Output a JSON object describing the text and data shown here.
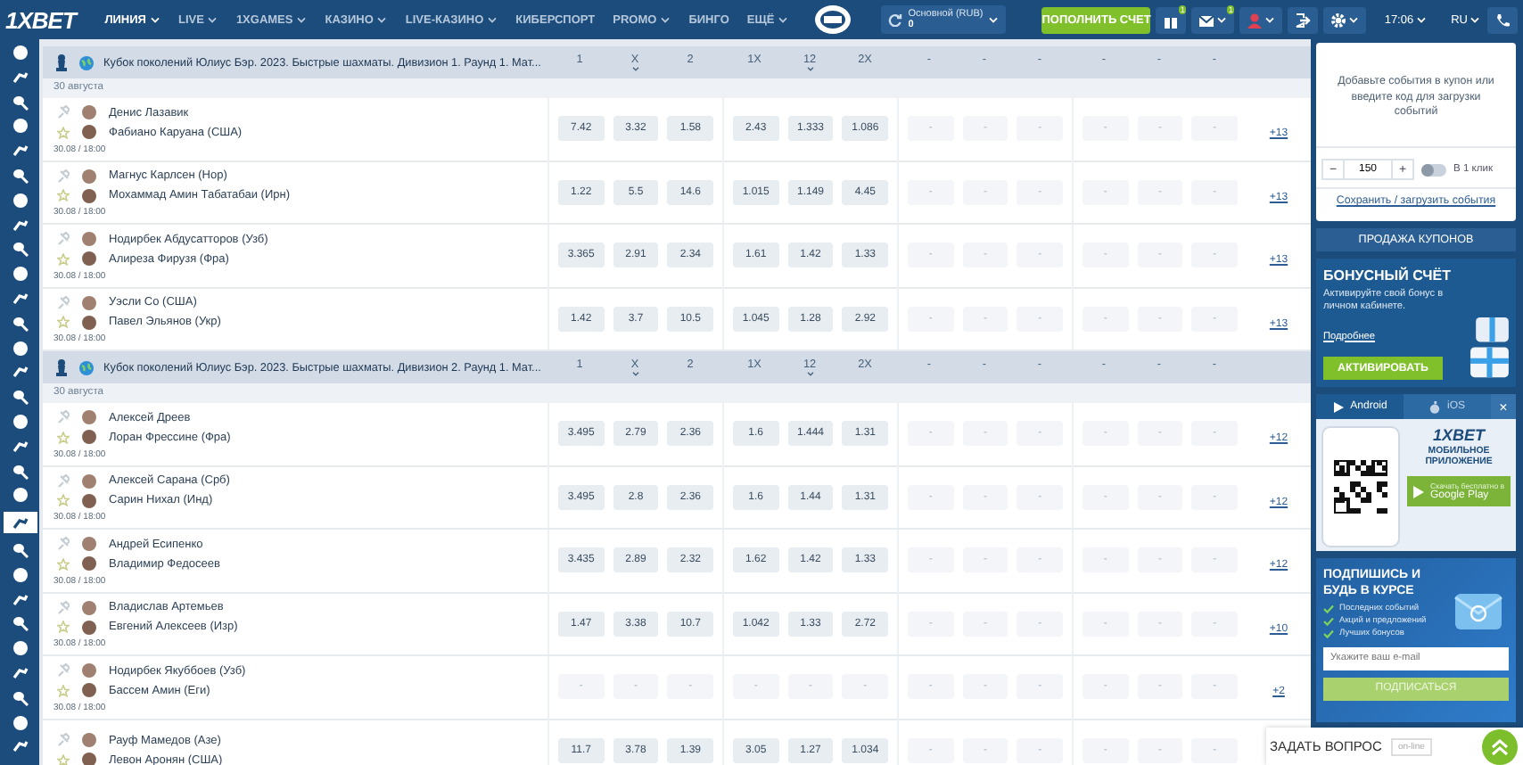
{
  "header": {
    "logo": "1XBET",
    "nav": [
      {
        "label": "ЛИНИЯ",
        "selected": true,
        "dropdown": true
      },
      {
        "label": "LIVE",
        "selected": false,
        "dropdown": true
      },
      {
        "label": "1XGAMES",
        "selected": false,
        "dropdown": true
      },
      {
        "label": "КАЗИНО",
        "selected": false,
        "dropdown": true
      },
      {
        "label": "LIVE-КАЗИНО",
        "selected": false,
        "dropdown": true
      },
      {
        "label": "КИБЕРСПОРТ",
        "selected": false,
        "dropdown": false
      },
      {
        "label": "PROMO",
        "selected": false,
        "dropdown": true
      },
      {
        "label": "БИНГО",
        "selected": false,
        "dropdown": false
      },
      {
        "label": "ЕЩЁ",
        "selected": false,
        "dropdown": true
      }
    ],
    "balance": {
      "account": "Основной (RUB)",
      "amount": "0"
    },
    "deposit_button": "ПОПОЛНИТЬ СЧЕТ",
    "gift_badge": "1",
    "mail_badge": "1",
    "time": "17:06",
    "language": "RU"
  },
  "sports_nav": [
    {
      "selected": false
    },
    {
      "selected": false
    },
    {
      "selected": false
    },
    {
      "selected": false
    },
    {
      "selected": false
    },
    {
      "selected": false
    },
    {
      "selected": false
    },
    {
      "selected": false
    },
    {
      "selected": false
    },
    {
      "selected": false
    },
    {
      "selected": false
    },
    {
      "selected": false
    },
    {
      "selected": false
    },
    {
      "selected": false
    },
    {
      "selected": false
    },
    {
      "selected": false
    },
    {
      "selected": false
    },
    {
      "selected": false
    },
    {
      "selected": false
    },
    {
      "selected": true
    },
    {
      "selected": false
    },
    {
      "selected": false
    },
    {
      "selected": false
    },
    {
      "selected": false
    },
    {
      "selected": false
    },
    {
      "selected": false
    },
    {
      "selected": false
    },
    {
      "selected": false
    },
    {
      "selected": false
    }
  ],
  "groups": [
    {
      "title": "Кубок поколений Юлиус Бэр. 2023. Быстрые шахматы. Дивизион 1. Раунд 1. Мат...",
      "date": "30 августа",
      "columns": [
        {
          "label": "1",
          "caret": false
        },
        {
          "label": "X",
          "caret": true
        },
        {
          "label": "2",
          "caret": false
        },
        {
          "label": "1X",
          "caret": false
        },
        {
          "label": "12",
          "caret": true
        },
        {
          "label": "2X",
          "caret": false
        }
      ],
      "extra_columns": [
        "-",
        "-",
        "-",
        "-",
        "-",
        "-"
      ],
      "matches": [
        {
          "team1": "Денис Лазавик",
          "team2": "Фабиано Каруана (США)",
          "when": "30.08 / 18:00",
          "locked": false,
          "odds": [
            "7.42",
            "3.32",
            "1.58",
            "2.43",
            "1.333",
            "1.086"
          ],
          "extra_odds": [
            "-",
            "-",
            "-",
            "-",
            "-",
            "-"
          ],
          "more": "+13"
        },
        {
          "team1": "Магнус Карлсен (Нор)",
          "team2": "Мохаммад Амин Табатабаи (Ирн)",
          "when": "30.08 / 18:00",
          "locked": false,
          "odds": [
            "1.22",
            "5.5",
            "14.6",
            "1.015",
            "1.149",
            "4.45"
          ],
          "extra_odds": [
            "-",
            "-",
            "-",
            "-",
            "-",
            "-"
          ],
          "more": "+13"
        },
        {
          "team1": "Нодирбек Абдусатторов (Узб)",
          "team2": "Алиреза Фирузя (Фра)",
          "when": "30.08 / 18:00",
          "locked": false,
          "odds": [
            "3.365",
            "2.91",
            "2.34",
            "1.61",
            "1.42",
            "1.33"
          ],
          "extra_odds": [
            "-",
            "-",
            "-",
            "-",
            "-",
            "-"
          ],
          "more": "+13"
        },
        {
          "team1": "Уэсли Со (США)",
          "team2": "Павел Эльянов (Укр)",
          "when": "30.08 / 18:00",
          "locked": false,
          "odds": [
            "1.42",
            "3.7",
            "10.5",
            "1.045",
            "1.28",
            "2.92"
          ],
          "extra_odds": [
            "-",
            "-",
            "-",
            "-",
            "-",
            "-"
          ],
          "more": "+13"
        }
      ]
    },
    {
      "title": "Кубок поколений Юлиус Бэр. 2023. Быстрые шахматы. Дивизион 2. Раунд 1. Мат...",
      "date": "30 августа",
      "columns": [
        {
          "label": "1",
          "caret": false
        },
        {
          "label": "X",
          "caret": true
        },
        {
          "label": "2",
          "caret": false
        },
        {
          "label": "1X",
          "caret": false
        },
        {
          "label": "12",
          "caret": true
        },
        {
          "label": "2X",
          "caret": false
        }
      ],
      "extra_columns": [
        "-",
        "-",
        "-",
        "-",
        "-",
        "-"
      ],
      "matches": [
        {
          "team1": "Алексей Дреев",
          "team2": "Лоран Фрессине (Фра)",
          "when": "30.08 / 18:00",
          "locked": false,
          "odds": [
            "3.495",
            "2.79",
            "2.36",
            "1.6",
            "1.444",
            "1.31"
          ],
          "extra_odds": [
            "-",
            "-",
            "-",
            "-",
            "-",
            "-"
          ],
          "more": "+12"
        },
        {
          "team1": "Алексей Сарана (Срб)",
          "team2": "Сарин Нихал (Инд)",
          "when": "30.08 / 18:00",
          "locked": false,
          "odds": [
            "3.495",
            "2.8",
            "2.36",
            "1.6",
            "1.44",
            "1.31"
          ],
          "extra_odds": [
            "-",
            "-",
            "-",
            "-",
            "-",
            "-"
          ],
          "more": "+12"
        },
        {
          "team1": "Андрей Есипенко",
          "team2": "Владимир Федосеев",
          "when": "30.08 / 18:00",
          "locked": false,
          "odds": [
            "3.435",
            "2.89",
            "2.32",
            "1.62",
            "1.42",
            "1.33"
          ],
          "extra_odds": [
            "-",
            "-",
            "-",
            "-",
            "-",
            "-"
          ],
          "more": "+12"
        },
        {
          "team1": "Владислав Артемьев",
          "team2": "Евгений Алексеев (Изр)",
          "when": "30.08 / 18:00",
          "locked": false,
          "odds": [
            "1.47",
            "3.38",
            "10.7",
            "1.042",
            "1.33",
            "2.72"
          ],
          "extra_odds": [
            "-",
            "-",
            "-",
            "-",
            "-",
            "-"
          ],
          "more": "+10"
        },
        {
          "team1": "Нодирбек Якуббоев (Узб)",
          "team2": "Бассем Амин (Еги)",
          "when": "30.08 / 18:00",
          "locked": true,
          "odds": [
            "-",
            "-",
            "-",
            "-",
            "-",
            "-"
          ],
          "extra_odds": [
            "-",
            "-",
            "-",
            "-",
            "-",
            "-"
          ],
          "more": "+2"
        },
        {
          "team1": "Рауф Мамедов (Азе)",
          "team2": "Левон Аронян (США)",
          "locked": false,
          "odds": [
            "11.7",
            "3.78",
            "1.39",
            "3.05",
            "1.27",
            "1.034"
          ],
          "extra_odds": [
            "-",
            "-",
            "-",
            "-",
            "-",
            "-"
          ]
        }
      ]
    }
  ],
  "coupon": {
    "message": "Добавьте события в купон или введите код для загрузки событий",
    "minus": "−",
    "stake": "150",
    "plus": "+",
    "one_click": {
      "label": "В 1 клик",
      "on": false
    },
    "save_link": "Сохранить / загрузить события"
  },
  "coupon_sale": "ПРОДАЖА КУПОНОВ",
  "bonus": {
    "title": "БОНУСНЫЙ СЧЁТ",
    "text": "Активируйте свой бонус в личном кабинете.",
    "link": "Подробнее",
    "button": "АКТИВИРОВАТЬ"
  },
  "app": {
    "tabs": [
      {
        "label": "Android",
        "selected": true
      },
      {
        "label": "iOS",
        "selected": false
      }
    ],
    "close": "×",
    "logo": "1XBET",
    "title": "МОБИЛЬНОЕ ПРИЛОЖЕНИЕ",
    "store_caption": "Скачать бесплатно в",
    "store": "Google Play"
  },
  "subscribe": {
    "title": "ПОДПИШИСЬ И БУДЬ В КУРСЕ",
    "items": [
      "Последних событий",
      "Акций и предложений",
      "Лучших бонусов"
    ],
    "placeholder": "Укажите ваш e-mail",
    "button": "ПОДПИСАТЬСЯ"
  },
  "ask": {
    "label": "ЗАДАТЬ ВОПРОС",
    "badge": "on-line"
  }
}
